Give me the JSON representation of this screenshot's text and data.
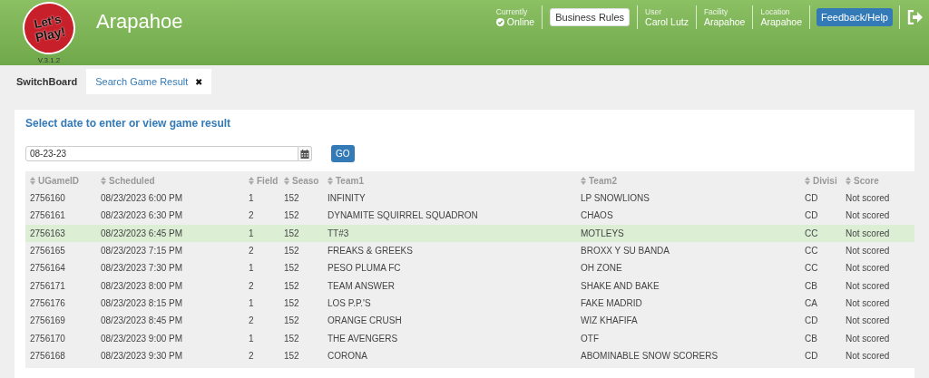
{
  "header": {
    "logo": {
      "lines": [
        "Let's",
        "Play!"
      ],
      "version": "V.3.1.2"
    },
    "title": "Arapahoe",
    "status": {
      "label": "Currently",
      "value": "Online",
      "online": true
    },
    "business_rules_button": "Business Rules",
    "info": [
      {
        "label": "User",
        "value": "Carol Lutz"
      },
      {
        "label": "Facility",
        "value": "Arapahoe"
      },
      {
        "label": "Location",
        "value": "Arapahoe"
      }
    ],
    "feedback_button": "Feedback/Help"
  },
  "tabs": [
    {
      "label": "SwitchBoard",
      "selected": false,
      "closable": false
    },
    {
      "label": "Search Game Result",
      "selected": true,
      "closable": true,
      "close_glyph": "✖"
    }
  ],
  "panel": {
    "heading": "Select date to enter or view game result",
    "date_field": {
      "value": "08-23-23"
    },
    "go_button": "GO",
    "table": {
      "columns": [
        "UGameID",
        "Scheduled",
        "Field",
        "Seaso",
        "Team1",
        "Team2",
        "Divisi",
        "Score"
      ],
      "rows": [
        {
          "selected": false,
          "cells": [
            "2756160",
            "08/23/2023 6:00 PM",
            "1",
            "152",
            "INFINITY",
            "LP SNOWLIONS",
            "CD",
            "Not scored"
          ]
        },
        {
          "selected": false,
          "cells": [
            "2756161",
            "08/23/2023 6:30 PM",
            "2",
            "152",
            "DYNAMITE SQUIRREL SQUADRON",
            "CHAOS",
            "CD",
            "Not scored"
          ]
        },
        {
          "selected": true,
          "cells": [
            "2756163",
            "08/23/2023 6:45 PM",
            "1",
            "152",
            "TT#3",
            "MOTLEYS",
            "CC",
            "Not scored"
          ]
        },
        {
          "selected": false,
          "cells": [
            "2756165",
            "08/23/2023 7:15 PM",
            "2",
            "152",
            "FREAKS & GREEKS",
            "BROXX Y SU BANDA",
            "CC",
            "Not scored"
          ]
        },
        {
          "selected": false,
          "cells": [
            "2756164",
            "08/23/2023 7:30 PM",
            "1",
            "152",
            "PESO PLUMA FC",
            "OH ZONE",
            "CC",
            "Not scored"
          ]
        },
        {
          "selected": false,
          "cells": [
            "2756171",
            "08/23/2023 8:00 PM",
            "2",
            "152",
            "TEAM ANSWER",
            "SHAKE AND BAKE",
            "CB",
            "Not scored"
          ]
        },
        {
          "selected": false,
          "cells": [
            "2756176",
            "08/23/2023 8:15 PM",
            "1",
            "152",
            "LOS P.P.'S",
            "FAKE MADRID",
            "CA",
            "Not scored"
          ]
        },
        {
          "selected": false,
          "cells": [
            "2756169",
            "08/23/2023 8:45 PM",
            "2",
            "152",
            "ORANGE CRUSH",
            "WIZ KHAFIFA",
            "CD",
            "Not scored"
          ]
        },
        {
          "selected": false,
          "cells": [
            "2756170",
            "08/23/2023 9:00 PM",
            "1",
            "152",
            "THE AVENGERS",
            "OTF",
            "CB",
            "Not scored"
          ]
        },
        {
          "selected": false,
          "cells": [
            "2756168",
            "08/23/2023 9:30 PM",
            "2",
            "152",
            "CORONA",
            "ABOMINABLE SNOW SCORERS",
            "CD",
            "Not scored"
          ]
        }
      ]
    }
  }
}
